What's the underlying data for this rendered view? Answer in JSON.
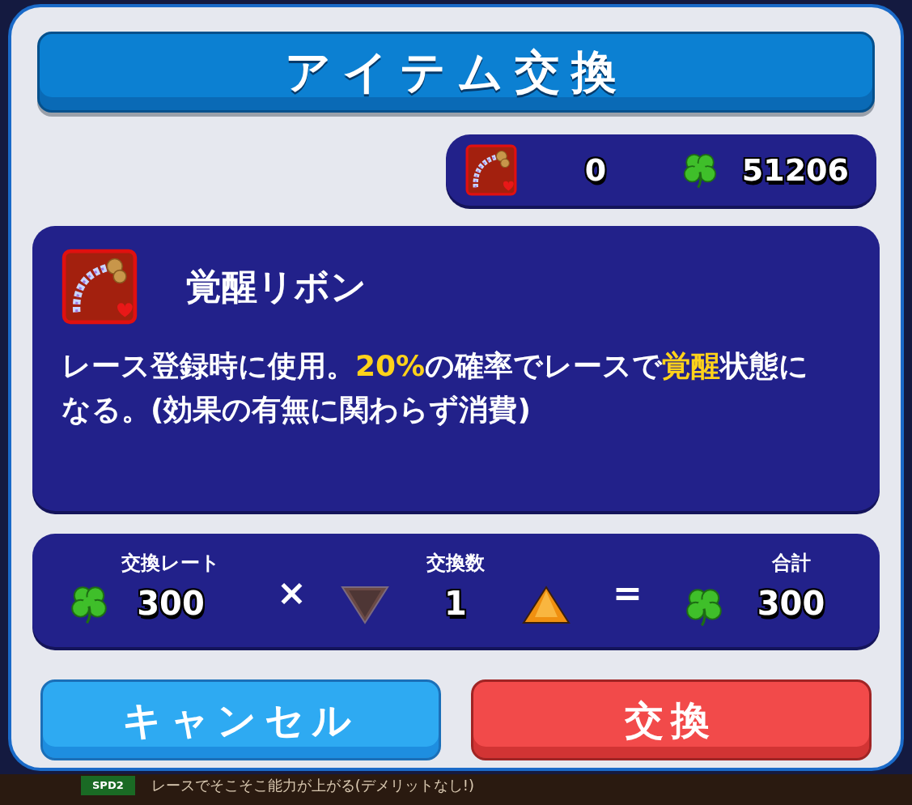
{
  "dialog": {
    "title": "アイテム交換"
  },
  "wallet": {
    "item_count": "0",
    "clover_count": "51206"
  },
  "item": {
    "name": "覚醒リボン",
    "description": [
      {
        "text": "レース登録時に使用。",
        "highlight": false
      },
      {
        "text": "20%",
        "highlight": true
      },
      {
        "text": "の確率でレースで",
        "highlight": false
      },
      {
        "text": "覚醒",
        "highlight": true
      },
      {
        "text": "状態になる。(効果の有無に関わらず消費)",
        "highlight": false
      }
    ]
  },
  "exchange": {
    "rate_label": "交換レート",
    "rate": "300",
    "times": "×",
    "count_label": "交換数",
    "count": "1",
    "decrease_disabled": true,
    "increase_disabled": false,
    "equals": "=",
    "total_label": "合計",
    "total": "300"
  },
  "buttons": [
    {
      "label": "キャンセル",
      "kind": "cancel"
    },
    {
      "label": "交換",
      "kind": "confirm"
    }
  ],
  "background": {
    "badge": "SPD2",
    "text": "レースでそこそこ能力が上がる(デメリットなし!)"
  }
}
